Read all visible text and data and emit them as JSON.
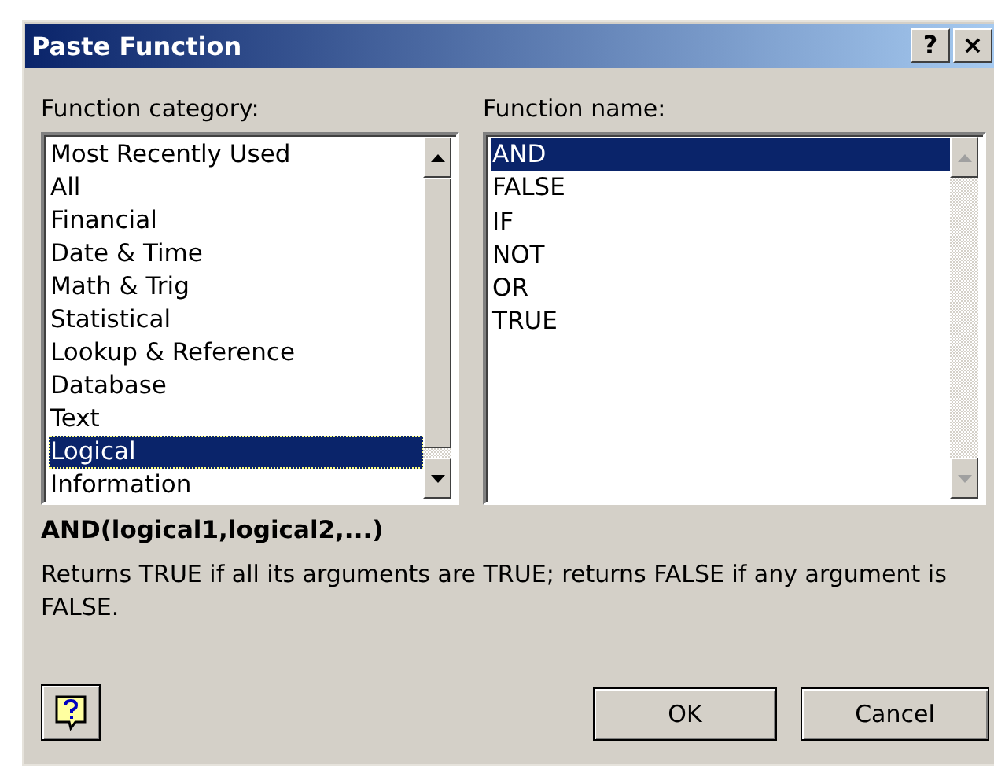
{
  "window": {
    "title": "Paste Function",
    "title_buttons": [
      "?",
      "×"
    ]
  },
  "category_list": {
    "label": "Function category:",
    "items": [
      {
        "label": "Most Recently Used",
        "selected": false
      },
      {
        "label": "All",
        "selected": false
      },
      {
        "label": "Financial",
        "selected": false
      },
      {
        "label": "Date & Time",
        "selected": false
      },
      {
        "label": "Math & Trig",
        "selected": false
      },
      {
        "label": "Statistical",
        "selected": false
      },
      {
        "label": "Lookup & Reference",
        "selected": false
      },
      {
        "label": "Database",
        "selected": false
      },
      {
        "label": "Text",
        "selected": false
      },
      {
        "label": "Logical",
        "selected": true
      },
      {
        "label": "Information",
        "selected": false
      }
    ]
  },
  "name_list": {
    "label": "Function name:",
    "items": [
      {
        "label": "AND",
        "selected": true
      },
      {
        "label": "FALSE",
        "selected": false
      },
      {
        "label": "IF",
        "selected": false
      },
      {
        "label": "NOT",
        "selected": false
      },
      {
        "label": "OR",
        "selected": false
      },
      {
        "label": "TRUE",
        "selected": false
      }
    ]
  },
  "syntax": "AND(logical1,logical2,...)",
  "description": "Returns TRUE if all its arguments are TRUE; returns FALSE if any argument is FALSE.",
  "buttons": [
    "OK",
    "Cancel"
  ]
}
